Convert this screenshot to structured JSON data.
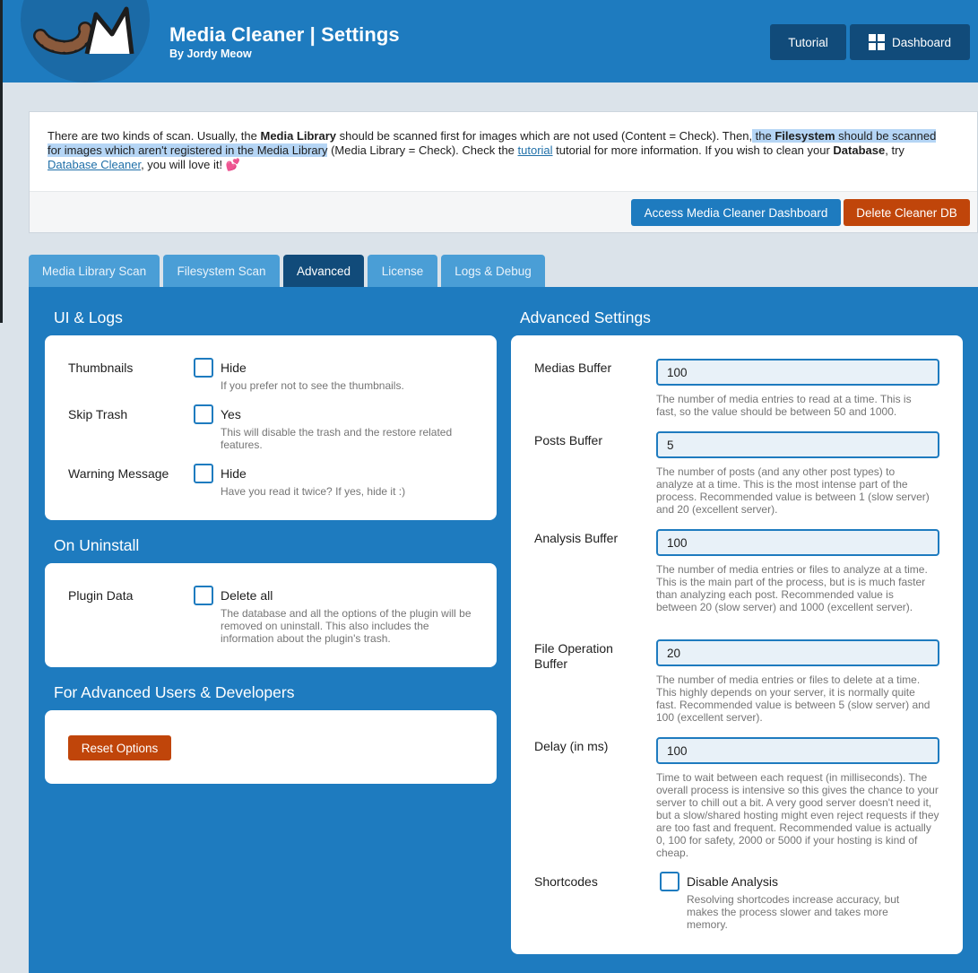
{
  "header": {
    "title": "Media Cleaner | Settings",
    "subtitle": "By Jordy Meow",
    "logo_letter": "M",
    "tutorial_label": "Tutorial",
    "dashboard_label": "Dashboard"
  },
  "info": {
    "t1": "There are two kinds of scan. Usually, the ",
    "b1": "Media Library",
    "t2": " should be scanned first for images which are not used (Content = Check). Then,",
    "h1": " the ",
    "hb": "Filesystem",
    "h2": " should be scanned for images which aren't registered in the Media Library",
    "t3": " (Media Library = Check). Check the ",
    "link1": "tutorial",
    "t4": " tutorial for more information. If you wish to clean your ",
    "b2": "Database",
    "t5": ", try ",
    "link2": "Database Cleaner",
    "t6": ", you will love it! ",
    "heart": "💕",
    "access_label": "Access Media Cleaner Dashboard",
    "delete_label": "Delete Cleaner DB"
  },
  "tabs": [
    {
      "label": "Media Library Scan"
    },
    {
      "label": "Filesystem Scan"
    },
    {
      "label": "Advanced"
    },
    {
      "label": "License"
    },
    {
      "label": "Logs & Debug"
    }
  ],
  "ui_logs": {
    "title": "UI & Logs",
    "rows": [
      {
        "label": "Thumbnails",
        "checkbox": "Hide",
        "desc": "If you prefer not to see the thumbnails."
      },
      {
        "label": "Skip Trash",
        "checkbox": "Yes",
        "desc": "This will disable the trash and the restore related features."
      },
      {
        "label": "Warning Message",
        "checkbox": "Hide",
        "desc": "Have you read it twice? If yes, hide it :)"
      }
    ]
  },
  "uninstall": {
    "title": "On Uninstall",
    "label": "Plugin Data",
    "checkbox": "Delete all",
    "desc": "The database and all the options of the plugin will be removed on uninstall. This also includes the information about the plugin's trash."
  },
  "developers": {
    "title": "For Advanced Users & Developers",
    "reset_label": "Reset Options"
  },
  "advanced": {
    "title": "Advanced Settings",
    "fields": [
      {
        "label": "Medias Buffer",
        "value": "100",
        "desc": "The number of media entries to read at a time. This is fast, so the value should be between 50 and 1000."
      },
      {
        "label": "Posts Buffer",
        "value": "5",
        "desc": "The number of posts (and any other post types) to analyze at a time. This is the most intense part of the process. Recommended value is between 1 (slow server) and 20 (excellent server)."
      },
      {
        "label": "Analysis Buffer",
        "value": "100",
        "desc": "The number of media entries or files to analyze at a time. This is the main part of the process, but is is much faster than analyzing each post. Recommended value is between 20 (slow server) and 1000 (excellent server)."
      },
      {
        "label": "File Operation Buffer",
        "value": "20",
        "desc": "The number of media entries or files to delete at a time. This highly depends on your server, it is normally quite fast. Recommended value is between 5 (slow server) and 100 (excellent server)."
      },
      {
        "label": "Delay (in ms)",
        "value": "100",
        "desc": "Time to wait between each request (in milliseconds). The overall process is intensive so this gives the chance to your server to chill out a bit. A very good server doesn't need it, but a slow/shared hosting might even reject requests if they are too fast and frequent. Recommended value is actually 0, 100 for safety, 2000 or 5000 if your hosting is kind of cheap."
      }
    ],
    "shortcodes": {
      "label": "Shortcodes",
      "checkbox": "Disable Analysis",
      "desc": "Resolving shortcodes increase accuracy, but makes the process slower and takes more memory."
    }
  },
  "colors": {
    "brand_blue": "#1e7bbf",
    "dark_blue": "#114b7a",
    "danger": "#c0450a"
  },
  "icons": {
    "dashboard": "grid-icon",
    "logo": "tail-logo-icon"
  }
}
